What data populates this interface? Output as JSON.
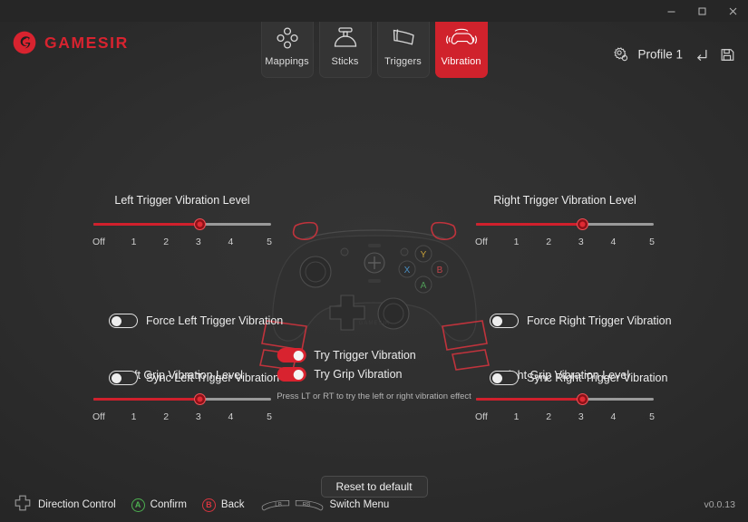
{
  "window": {
    "minimize_label": "Minimize",
    "maximize_label": "Maximize",
    "close_label": "Close"
  },
  "header": {
    "brand": "GAMESIR",
    "brand_color": "#d8232f",
    "logo_icon": "gamesir-logo-icon",
    "tabs": [
      {
        "id": "mappings",
        "label": "Mappings",
        "icon": "mappings-icon",
        "active": false
      },
      {
        "id": "sticks",
        "label": "Sticks",
        "icon": "sticks-icon",
        "active": false
      },
      {
        "id": "triggers",
        "label": "Triggers",
        "icon": "triggers-icon",
        "active": false
      },
      {
        "id": "vibration",
        "label": "Vibration",
        "icon": "gamepad-vibration-icon",
        "active": true
      }
    ],
    "active_tab": "Vibration",
    "active_tab_color": "#d0222c",
    "profile": {
      "gear_icon": "gear-profile-icon",
      "name": "Profile 1",
      "reset_icon": "undo-arrow-icon",
      "save_icon": "floppy-save-icon"
    }
  },
  "main": {
    "sliders": [
      {
        "id": "left-trigger",
        "title": "Left Trigger Vibration Level",
        "value": 3,
        "min": 0,
        "max": 5,
        "ticks": [
          "Off",
          "1",
          "2",
          "3",
          "4",
          "5"
        ],
        "fill_color": "#d0202c",
        "track_color": "#9a9a9a"
      },
      {
        "id": "right-trigger",
        "title": "Right Trigger Vibration Level",
        "value": 3,
        "min": 0,
        "max": 5,
        "ticks": [
          "Off",
          "1",
          "2",
          "3",
          "4",
          "5"
        ],
        "fill_color": "#d0202c",
        "track_color": "#9a9a9a"
      },
      {
        "id": "left-grip",
        "title": "Left Grip Vibration Level",
        "value": 3,
        "min": 0,
        "max": 5,
        "ticks": [
          "Off",
          "1",
          "2",
          "3",
          "4",
          "5"
        ],
        "fill_color": "#d0202c",
        "track_color": "#9a9a9a"
      },
      {
        "id": "right-grip",
        "title": "Right Grip Vibration Level",
        "value": 3,
        "min": 0,
        "max": 5,
        "ticks": [
          "Off",
          "1",
          "2",
          "3",
          "4",
          "5"
        ],
        "fill_color": "#d0202c",
        "track_color": "#9a9a9a"
      }
    ],
    "toggles": [
      {
        "id": "force-left-trigger",
        "label": "Force Left Trigger Vibration",
        "on": false
      },
      {
        "id": "sync-left-trigger",
        "label": "Sync Left Trigger Vibration",
        "on": false
      },
      {
        "id": "force-right-trigger",
        "label": "Force Right Trigger Vibration",
        "on": false
      },
      {
        "id": "sync-right-trigger",
        "label": "Sync Right Trigger Vibration",
        "on": false
      },
      {
        "id": "try-trigger",
        "label": "Try Trigger Vibration",
        "on": true
      },
      {
        "id": "try-grip",
        "label": "Try Grip Vibration",
        "on": true
      }
    ],
    "try_hint": "Press LT or RT to try the left or right vibration effect",
    "reset_button": "Reset to default",
    "controller": {
      "icon": "gamepad-illustration",
      "face_buttons": [
        {
          "label": "Y",
          "color": "#c8a13a"
        },
        {
          "label": "X",
          "color": "#4a8fc4"
        },
        {
          "label": "B",
          "color": "#c4444a"
        },
        {
          "label": "A",
          "color": "#4f9a57"
        }
      ],
      "highlight_color": "#c0333c"
    }
  },
  "footer": {
    "hints": [
      {
        "id": "direction",
        "icon": "dpad-icon",
        "label": "Direction Control"
      },
      {
        "id": "confirm",
        "icon": "a-button-icon",
        "label": "Confirm",
        "badge": "A",
        "badge_color": "#4caf50"
      },
      {
        "id": "back",
        "icon": "b-button-icon",
        "label": "Back",
        "badge": "B",
        "badge_color": "#d8353f"
      },
      {
        "id": "switch",
        "icon": "bumper-icon",
        "label": "Switch Menu",
        "bumpers": [
          "LB",
          "RB"
        ]
      }
    ],
    "version": "v0.0.13"
  }
}
